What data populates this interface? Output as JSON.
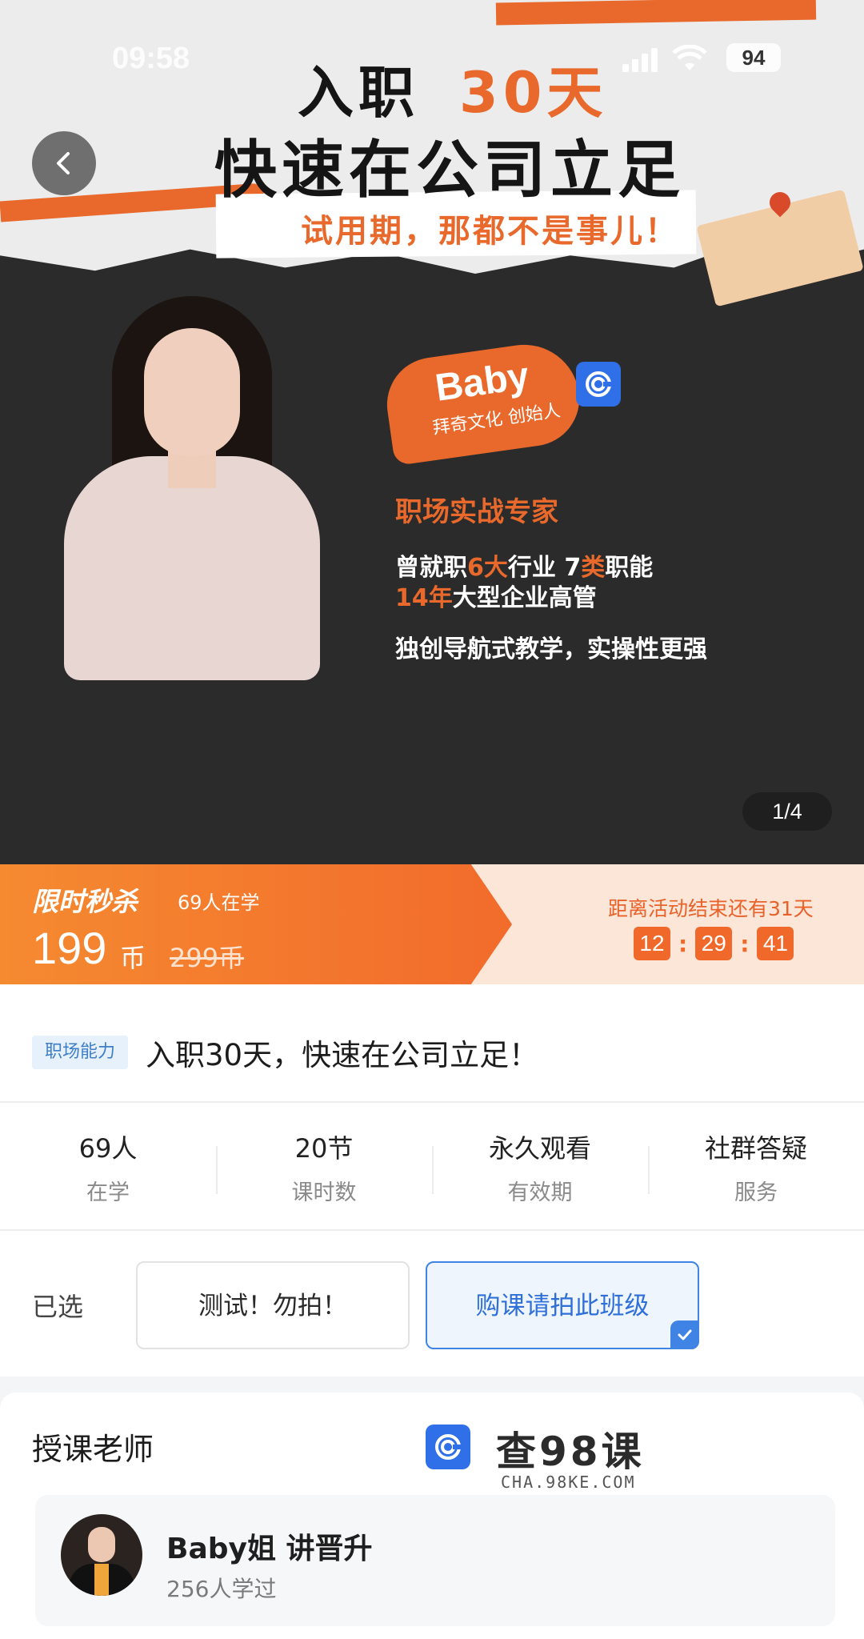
{
  "status_bar": {
    "time": "09:58",
    "battery": "94"
  },
  "hero": {
    "title_line1_prefix": "入职",
    "title_line1_accent": "30天",
    "title_line2": "快速在公司立足",
    "subtitle": "试用期，那都不是事儿！",
    "instructor_name": "Baby",
    "instructor_role": "拜奇文化 创始人",
    "expert_title": "职场实战专家",
    "line1_a": "曾就职",
    "line1_b": "6大",
    "line1_c": "行业  7",
    "line1_d": "类",
    "line1_e": "职能",
    "line2_a": "14年",
    "line2_b": "大型企业高管",
    "line3": "独创导航式教学，实操性更强",
    "pager": "1/4"
  },
  "promo": {
    "tag": "限时秒杀",
    "learners": "69人在学",
    "price": "199",
    "price_unit": "币",
    "original_price": "299币",
    "ends_text": "距离活动结束还有31天",
    "timer": {
      "hours": "12",
      "minutes": "29",
      "seconds": "41"
    }
  },
  "course": {
    "category": "职场能力",
    "title": "入职30天，快速在公司立足！",
    "stats": [
      {
        "value": "69人",
        "label": "在学"
      },
      {
        "value": "20节",
        "label": "课时数"
      },
      {
        "value": "永久观看",
        "label": "有效期"
      },
      {
        "value": "社群答疑",
        "label": "服务"
      }
    ],
    "chosen_label": "已选",
    "options": [
      {
        "label": "测试！勿拍！",
        "selected": false
      },
      {
        "label": "购课请拍此班级",
        "selected": true
      }
    ]
  },
  "teacher": {
    "heading": "授课老师",
    "name": "Baby姐 讲晋升",
    "learners": "256人学过"
  },
  "watermark": {
    "text": "查98课",
    "url": "CHA.98KE.COM"
  },
  "colors": {
    "accent": "#e8692b",
    "selected": "#3f84e5",
    "tag_blue": "#3f7fc7"
  }
}
